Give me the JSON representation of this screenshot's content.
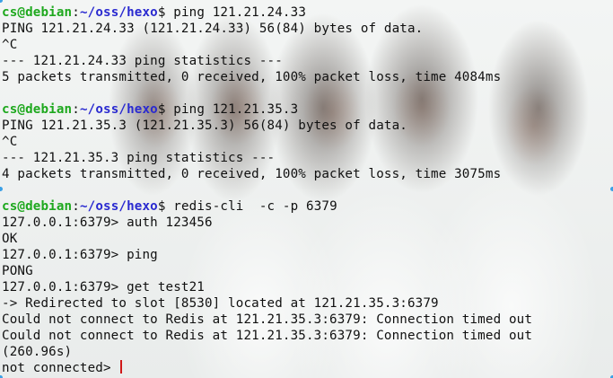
{
  "colors": {
    "prompt_user": "#1ea81e",
    "prompt_path": "#2a2ad0",
    "text": "#101010",
    "cursor": "#d01818",
    "selection_handle": "#3ba0e6"
  },
  "terminal": {
    "lines": [
      {
        "type": "prompt",
        "user_host": "cs@debian",
        "colon": ":",
        "path": "~/oss/hexo",
        "symbol": "$",
        "command": " ping 121.21.24.33"
      },
      {
        "type": "text",
        "text": "PING 121.21.24.33 (121.21.24.33) 56(84) bytes of data."
      },
      {
        "type": "text",
        "text": "^C"
      },
      {
        "type": "text",
        "text": "--- 121.21.24.33 ping statistics ---"
      },
      {
        "type": "text",
        "text": "5 packets transmitted, 0 received, 100% packet loss, time 4084ms"
      },
      {
        "type": "text",
        "text": ""
      },
      {
        "type": "prompt",
        "user_host": "cs@debian",
        "colon": ":",
        "path": "~/oss/hexo",
        "symbol": "$",
        "command": " ping 121.21.35.3"
      },
      {
        "type": "text",
        "text": "PING 121.21.35.3 (121.21.35.3) 56(84) bytes of data."
      },
      {
        "type": "text",
        "text": "^C"
      },
      {
        "type": "text",
        "text": "--- 121.21.35.3 ping statistics ---"
      },
      {
        "type": "text",
        "text": "4 packets transmitted, 0 received, 100% packet loss, time 3075ms"
      },
      {
        "type": "text",
        "text": ""
      },
      {
        "type": "prompt",
        "user_host": "cs@debian",
        "colon": ":",
        "path": "~/oss/hexo",
        "symbol": "$",
        "command": " redis-cli  -c -p 6379"
      },
      {
        "type": "text",
        "text": "127.0.0.1:6379> auth 123456"
      },
      {
        "type": "text",
        "text": "OK"
      },
      {
        "type": "text",
        "text": "127.0.0.1:6379> ping"
      },
      {
        "type": "text",
        "text": "PONG"
      },
      {
        "type": "text",
        "text": "127.0.0.1:6379> get test21"
      },
      {
        "type": "text",
        "text": "-> Redirected to slot [8530] located at 121.21.35.3:6379"
      },
      {
        "type": "text",
        "text": "Could not connect to Redis at 121.21.35.3:6379: Connection timed out"
      },
      {
        "type": "text",
        "text": "Could not connect to Redis at 121.21.35.3:6379: Connection timed out"
      },
      {
        "type": "text",
        "text": "(260.96s)"
      },
      {
        "type": "input",
        "text": "not connected> "
      }
    ]
  }
}
